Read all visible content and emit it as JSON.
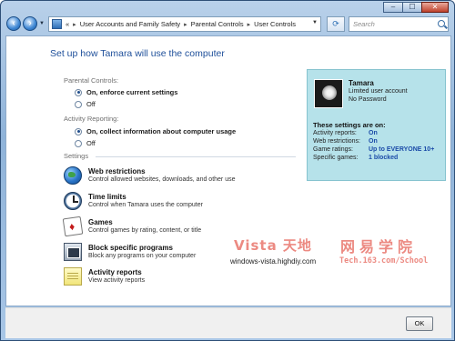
{
  "window": {
    "caption_buttons": [
      "–",
      "☐",
      "✕"
    ]
  },
  "nav": {
    "back_icon": "back-arrow-icon",
    "forward_icon": "forward-arrow-icon",
    "breadcrumb_overflow": "«",
    "breadcrumb": [
      "User Accounts and Family Safety",
      "Parental Controls",
      "User Controls"
    ],
    "search_placeholder": "Search"
  },
  "main": {
    "title": "Set up how Tamara will use the computer",
    "parental_controls": {
      "label": "Parental Controls:",
      "options": [
        {
          "label": "On, enforce current settings",
          "checked": true
        },
        {
          "label": "Off",
          "checked": false
        }
      ]
    },
    "activity_reporting": {
      "label": "Activity Reporting:",
      "options": [
        {
          "label": "On, collect information about computer usage",
          "checked": true
        },
        {
          "label": "Off",
          "checked": false
        }
      ]
    },
    "settings_label": "Settings",
    "settings": [
      {
        "title": "Web restrictions",
        "desc": "Control allowed websites, downloads, and other use",
        "icon": "globe-icon"
      },
      {
        "title": "Time limits",
        "desc": "Control when Tamara uses the computer",
        "icon": "clock-icon"
      },
      {
        "title": "Games",
        "desc": "Control games by rating, content, or title",
        "icon": "cards-icon"
      },
      {
        "title": "Block specific programs",
        "desc": "Block any programs on your computer",
        "icon": "block-programs-icon"
      },
      {
        "title": "Activity reports",
        "desc": "View activity reports",
        "icon": "report-icon"
      }
    ]
  },
  "user_panel": {
    "name": "Tamara",
    "account_type": "Limited user account",
    "password": "No Password",
    "settings_header": "These settings are on:",
    "items": [
      {
        "key": "Activity reports:",
        "value": "On"
      },
      {
        "key": "Web restrictions:",
        "value": "On"
      },
      {
        "key": "Game ratings:",
        "value": "Up to EVERYONE 10+"
      },
      {
        "key": "Specific games:",
        "value": "1 blocked"
      }
    ]
  },
  "watermark": {
    "line1": "Vista 天地",
    "line2": "网易学院",
    "url1": "windows-vista.highdiy.com",
    "url2": "Tech.163.com/School"
  },
  "footer": {
    "ok_label": "OK"
  },
  "colors": {
    "title_blue": "#1e4f9a",
    "panel_bg": "#b6e2ea",
    "value_blue": "#1b4ba8",
    "watermark": "#ec8a82"
  }
}
